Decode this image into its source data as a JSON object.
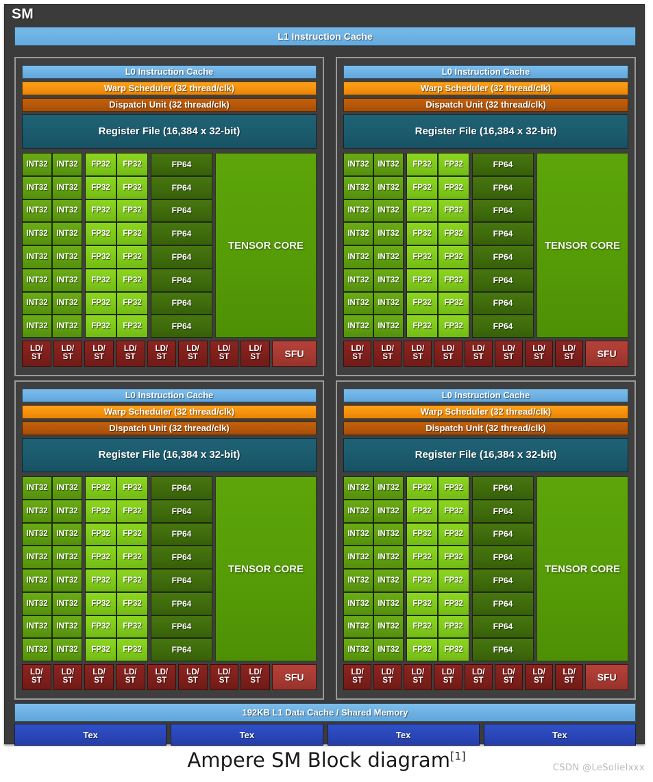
{
  "diagram": {
    "title": "SM",
    "caption_text": "Ampere SM Block diagram",
    "caption_ref": "[1]",
    "watermark": "CSDN @LeSolielxxx"
  },
  "top_cache": {
    "label": "L1 Instruction Cache",
    "color": "#6cb0e3"
  },
  "processing_block": {
    "l0_cache_label": "L0 Instruction Cache",
    "warp_scheduler_label": "Warp Scheduler (32 thread/clk)",
    "dispatch_unit_label": "Dispatch Unit (32 thread/clk)",
    "register_file_label": "Register File (16,384 x 32-bit)",
    "tensor_core_label": "TENSOR CORE",
    "int32_label": "INT32",
    "fp32_label": "FP32",
    "fp64_label": "FP64",
    "ldst_label_line1": "LD/",
    "ldst_label_line2": "ST",
    "sfu_label": "SFU",
    "rows": 8,
    "int32_columns": 2,
    "fp32_columns": 2,
    "fp64_columns": 1,
    "ldst_count": 8,
    "sfu_count": 1,
    "colors": {
      "l0_cache": "#6cb0e3",
      "warp_scheduler": "#f4900c",
      "dispatch_unit": "#b4560a",
      "register_file": "#1b5a6c",
      "int32": "#5f9e11",
      "fp32": "#7fc91a",
      "fp64": "#3f6b0c",
      "tensor_core": "#569c07",
      "ldst": "#7e1f1b",
      "sfu": "#a63a32"
    }
  },
  "quadrants": [
    {
      "name": "processing-block-0"
    },
    {
      "name": "processing-block-1"
    },
    {
      "name": "processing-block-2"
    },
    {
      "name": "processing-block-3"
    }
  ],
  "shared_memory": {
    "label": "192KB L1 Data Cache / Shared Memory",
    "color": "#6cb0e3"
  },
  "tex_units": {
    "label": "Tex",
    "count": 4,
    "color": "#2a46b8"
  },
  "chassis": {
    "background": "#3b3b3b",
    "panel_border": "#9a9a9a"
  }
}
